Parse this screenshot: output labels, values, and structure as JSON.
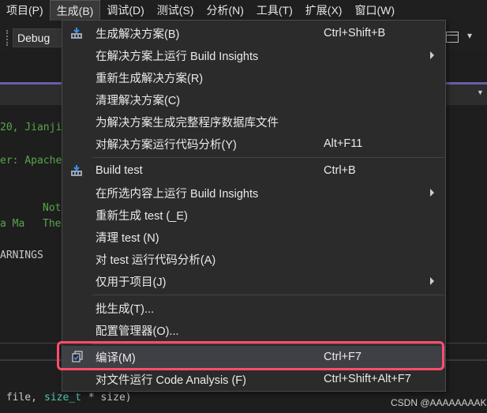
{
  "menubar": {
    "items": [
      {
        "label": "项目(P)"
      },
      {
        "label": "生成(B)"
      },
      {
        "label": "调试(D)"
      },
      {
        "label": "测试(S)"
      },
      {
        "label": "分析(N)"
      },
      {
        "label": "工具(T)"
      },
      {
        "label": "扩展(X)"
      },
      {
        "label": "窗口(W)"
      }
    ],
    "active": "生成(B)"
  },
  "toolbar": {
    "configuration": "Debug"
  },
  "editor": {
    "lines": [
      "20, Jianji",
      "er: Apache",
      "Not",
      "a Ma",
      "The",
      "ARNINGS",
      " file, ",
      "size_t",
      " * size)"
    ]
  },
  "build_menu": {
    "items": [
      {
        "label": "生成解决方案(B)",
        "shortcut": "Ctrl+Shift+B",
        "icon": "build-solution-icon"
      },
      {
        "label": "在解决方案上运行 Build Insights",
        "submenu": true
      },
      {
        "label": "重新生成解决方案(R)"
      },
      {
        "label": "清理解决方案(C)"
      },
      {
        "label": "为解决方案生成完整程序数据库文件"
      },
      {
        "label": "对解决方案运行代码分析(Y)",
        "shortcut": "Alt+F11"
      },
      {
        "label": "Build test",
        "shortcut": "Ctrl+B",
        "icon": "build-project-icon"
      },
      {
        "label": "在所选内容上运行 Build Insights",
        "submenu": true
      },
      {
        "label": "重新生成 test (_E)"
      },
      {
        "label": "清理 test (N)"
      },
      {
        "label": "对 test 运行代码分析(A)"
      },
      {
        "label": "仅用于项目(J)",
        "submenu": true
      },
      {
        "label": "批生成(T)..."
      },
      {
        "label": "配置管理器(O)..."
      },
      {
        "label": "编译(M)",
        "shortcut": "Ctrl+F7",
        "icon": "compile-icon",
        "highlighted": true
      },
      {
        "label": "对文件运行 Code Analysis (F)",
        "shortcut": "Ctrl+Shift+Alt+F7"
      }
    ]
  },
  "watermark": "CSDN @AAAAAAAAKui",
  "colors": {
    "accent_strip": "#6c5ea8",
    "highlight_border": "#ff4d6d",
    "comment_green": "#57a64a",
    "type_teal": "#4ec9b0"
  }
}
